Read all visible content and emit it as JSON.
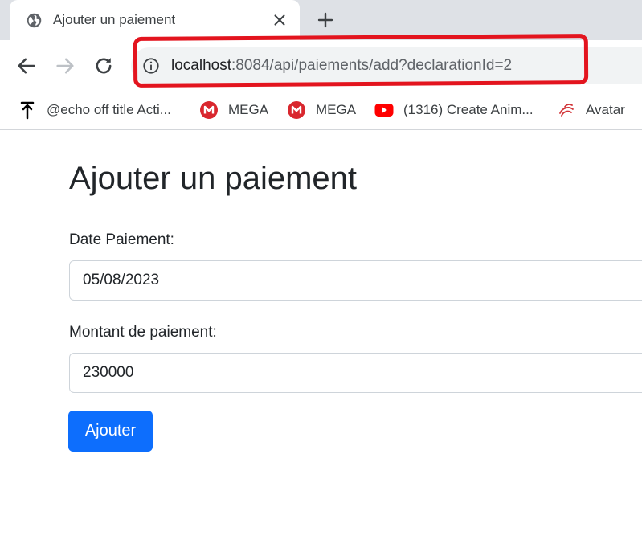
{
  "browser": {
    "tab": {
      "title": "Ajouter un paiement",
      "favicon_icon": "globe-icon",
      "close_icon": "close-icon"
    },
    "new_tab_icon": "plus-icon",
    "nav": {
      "back_icon": "arrow-left-icon",
      "forward_icon": "arrow-right-icon",
      "reload_icon": "reload-icon"
    },
    "omnibox": {
      "info_icon": "info-icon",
      "url_host": "localhost",
      "url_rest": ":8084/api/paiements/add?declarationId=2"
    },
    "highlight_color": "#e3141e",
    "bookmarks": [
      {
        "label": "@echo off title Acti...",
        "icon": "pin-icon"
      },
      {
        "label": "MEGA",
        "icon": "mega-icon"
      },
      {
        "label": "MEGA",
        "icon": "mega-icon"
      },
      {
        "label": "(1316) Create Anim...",
        "icon": "youtube-icon"
      },
      {
        "label": "Avatar",
        "icon": "swirl-icon"
      }
    ]
  },
  "page": {
    "title": "Ajouter un paiement",
    "form": {
      "date_label": "Date Paiement:",
      "date_value": "05/08/2023",
      "amount_label": "Montant de paiement:",
      "amount_value": "230000",
      "submit_label": "Ajouter"
    },
    "colors": {
      "primary": "#0d6efd",
      "text": "#212529",
      "input_border": "#ced4da"
    }
  }
}
